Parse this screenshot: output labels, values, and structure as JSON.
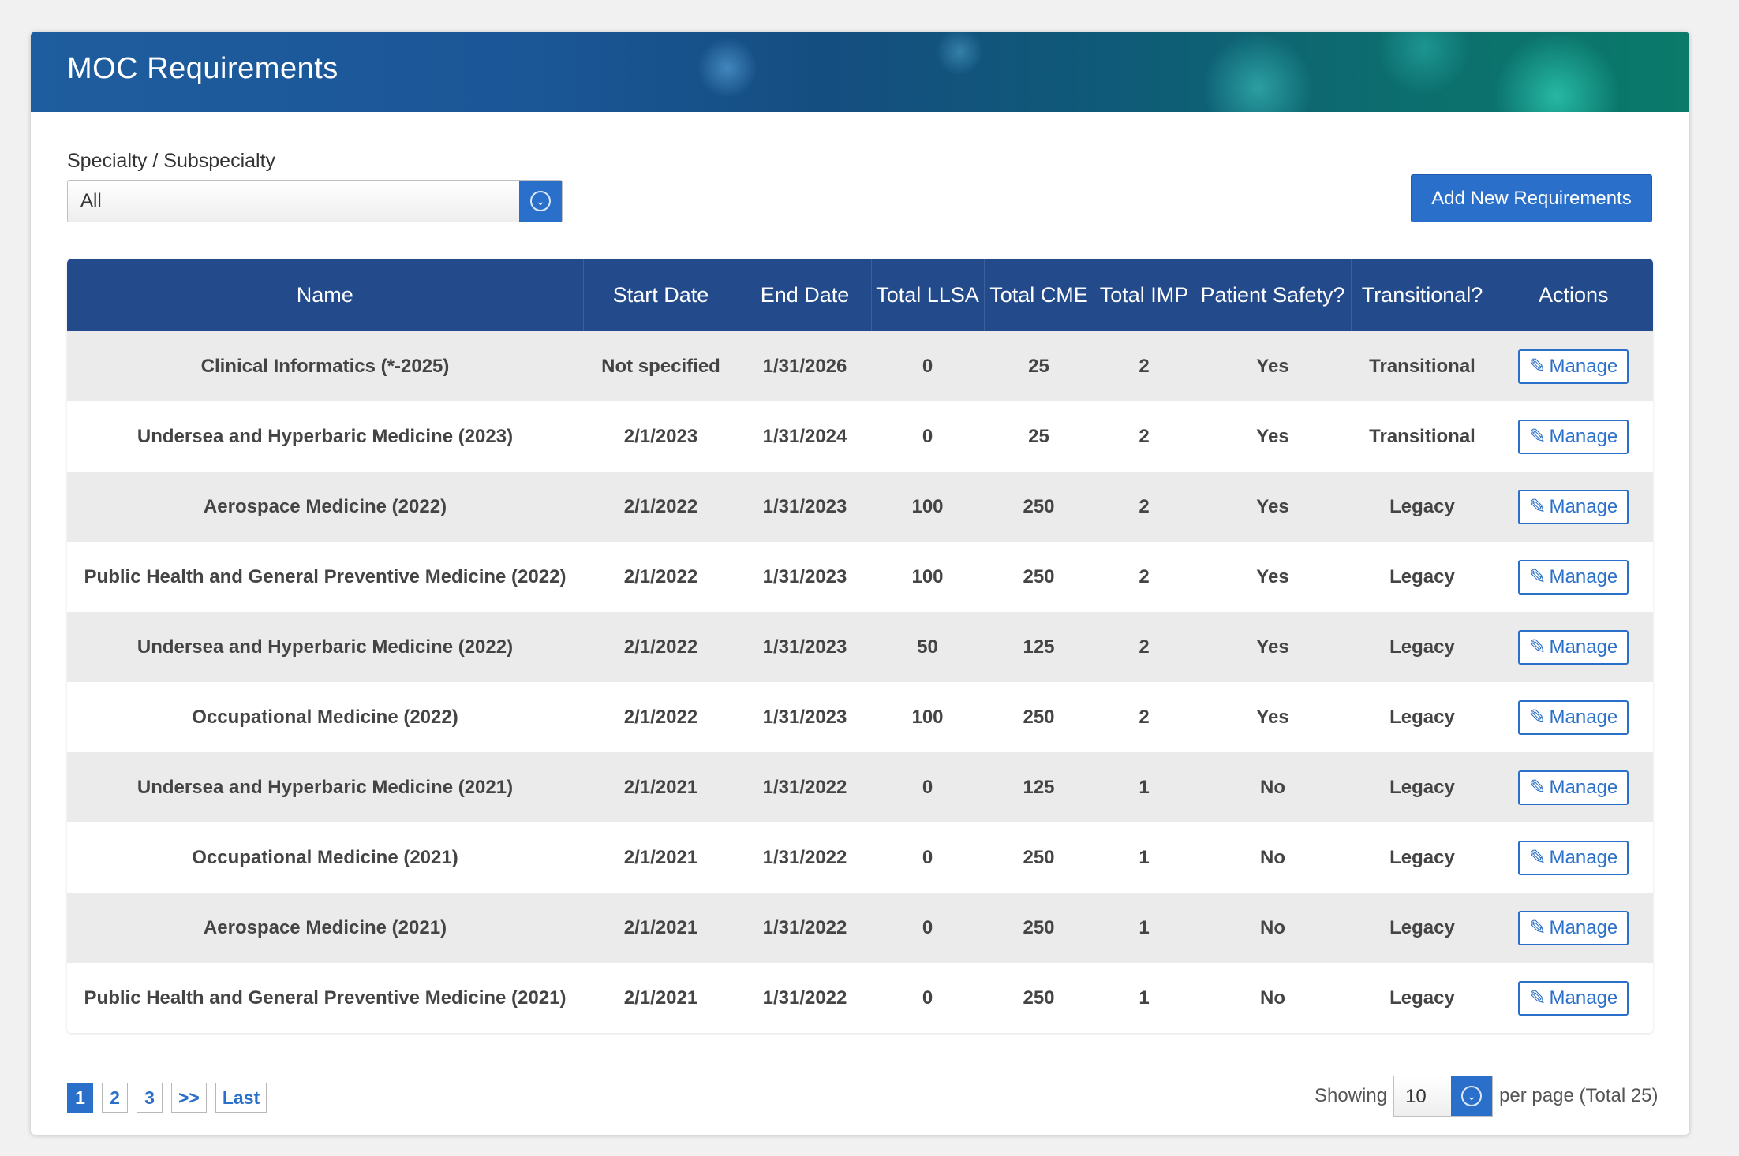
{
  "header": {
    "title": "MOC Requirements"
  },
  "filter": {
    "label": "Specialty / Subspecialty",
    "selected": "All"
  },
  "add_button_label": "Add New Requirements",
  "table": {
    "columns": [
      "Name",
      "Start Date",
      "End Date",
      "Total LLSA",
      "Total CME",
      "Total IMP",
      "Patient Safety?",
      "Transitional?",
      "Actions"
    ],
    "action_label": "Manage",
    "rows": [
      [
        "Clinical Informatics (*-2025)",
        "Not specified",
        "1/31/2026",
        "0",
        "25",
        "2",
        "Yes",
        "Transitional"
      ],
      [
        "Undersea and Hyperbaric Medicine (2023)",
        "2/1/2023",
        "1/31/2024",
        "0",
        "25",
        "2",
        "Yes",
        "Transitional"
      ],
      [
        "Aerospace Medicine (2022)",
        "2/1/2022",
        "1/31/2023",
        "100",
        "250",
        "2",
        "Yes",
        "Legacy"
      ],
      [
        "Public Health and General Preventive Medicine (2022)",
        "2/1/2022",
        "1/31/2023",
        "100",
        "250",
        "2",
        "Yes",
        "Legacy"
      ],
      [
        "Undersea and Hyperbaric Medicine (2022)",
        "2/1/2022",
        "1/31/2023",
        "50",
        "125",
        "2",
        "Yes",
        "Legacy"
      ],
      [
        "Occupational Medicine (2022)",
        "2/1/2022",
        "1/31/2023",
        "100",
        "250",
        "2",
        "Yes",
        "Legacy"
      ],
      [
        "Undersea and Hyperbaric Medicine (2021)",
        "2/1/2021",
        "1/31/2022",
        "0",
        "125",
        "1",
        "No",
        "Legacy"
      ],
      [
        "Occupational Medicine (2021)",
        "2/1/2021",
        "1/31/2022",
        "0",
        "250",
        "1",
        "No",
        "Legacy"
      ],
      [
        "Aerospace Medicine (2021)",
        "2/1/2021",
        "1/31/2022",
        "0",
        "250",
        "1",
        "No",
        "Legacy"
      ],
      [
        "Public Health and General Preventive Medicine (2021)",
        "2/1/2021",
        "1/31/2022",
        "0",
        "250",
        "1",
        "No",
        "Legacy"
      ]
    ]
  },
  "pagination": {
    "pages": [
      "1",
      "2",
      "3"
    ],
    "next_label": ">>",
    "last_label": "Last",
    "current": "1"
  },
  "per_page": {
    "showing_label": "Showing",
    "value": "10",
    "suffix": "per page (Total 25)"
  },
  "icons": {
    "select_chevron": "chevron-down-icon",
    "manage": "pencil-icon"
  },
  "colors": {
    "accent": "#2a6fc9",
    "table_header": "#234a8a"
  }
}
